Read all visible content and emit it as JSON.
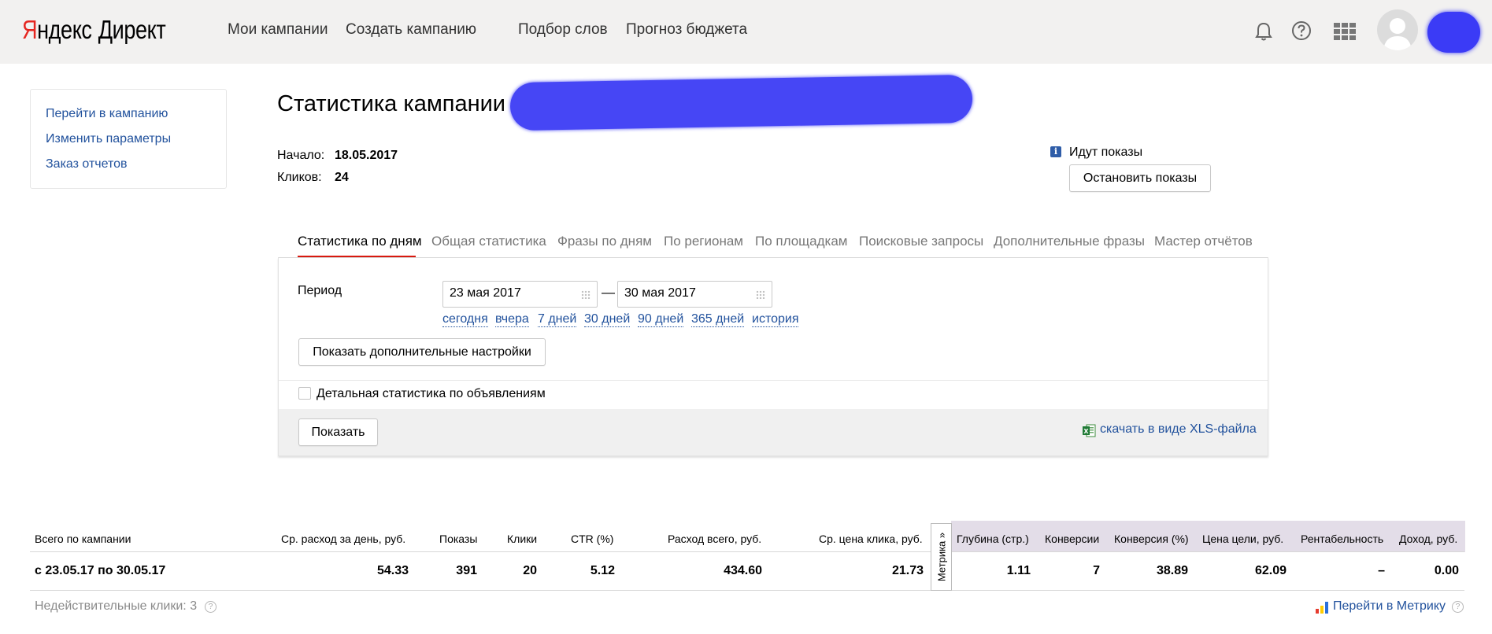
{
  "header": {
    "logo_y": "Я",
    "logo_rest": "ндекс",
    "logo_product": "Директ",
    "nav": [
      "Мои кампании",
      "Создать кампанию",
      "Подбор слов",
      "Прогноз бюджета"
    ],
    "icons": [
      "bell-icon",
      "help-icon",
      "apps-grid-icon",
      "user-avatar",
      "account-menu"
    ]
  },
  "sidebar": {
    "links": [
      "Перейти в кампанию",
      "Изменить параметры",
      "Заказ отчетов"
    ]
  },
  "campaign": {
    "title": "Статистика кампании",
    "start_label": "Начало:",
    "start_value": "18.05.2017",
    "clicks_label": "Кликов:",
    "clicks_value": "24",
    "status_text": "Идут показы",
    "stop_button": "Остановить показы"
  },
  "tabs": [
    "Статистика по дням",
    "Общая статистика",
    "Фразы по дням",
    "По регионам",
    "По площадкам",
    "Поисковые запросы",
    "Дополнительные фразы",
    "Мастер отчётов"
  ],
  "filter": {
    "period_label": "Период",
    "date_from": "23 мая 2017",
    "date_to": "30 мая 2017",
    "dash": "—",
    "quick_links": [
      "сегодня",
      "вчера",
      "7 дней",
      "30 дней",
      "90 дней",
      "365 дней",
      "история"
    ],
    "advanced_button": "Показать дополнительные настройки",
    "detail_checkbox_label": "Детальная статистика по объявлениям",
    "show_button": "Показать",
    "xls_link": "скачать в виде XLS-файла"
  },
  "stats": {
    "headers": [
      "Всего по кампании",
      "Ср. расход за день, руб.",
      "Показы",
      "Клики",
      "CTR (%)",
      "Расход всего, руб.",
      "Ср. цена клика, руб.",
      "Глубина (стр.)",
      "Конверсии",
      "Конверсия (%)",
      "Цена цели, руб.",
      "Рентабельность",
      "Доход, руб."
    ],
    "row": [
      "с 23.05.17 по 30.05.17",
      "54.33",
      "391",
      "20",
      "5.12",
      "434.60",
      "21.73",
      "1.11",
      "7",
      "38.89",
      "62.09",
      "–",
      "0.00"
    ],
    "metrika_tab": "Метрика »",
    "invalid_clicks": "Недействительные клики: 3",
    "metrika_link": "Перейти в Метрику"
  }
}
